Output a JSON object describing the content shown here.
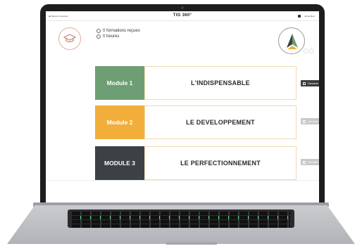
{
  "app": {
    "brand": "TIG 360°",
    "back_label": "Retour à l'accueil",
    "user_label": "Annie Rice"
  },
  "summary": {
    "trainings_received": "0 formations reçues",
    "hours": "0 heures"
  },
  "logo": {
    "trail_text": "◯◯"
  },
  "modules": [
    {
      "label": "Module 1",
      "title": "L'INDISPENSABLE",
      "status": "Démarrer",
      "color": "#6e9e74",
      "status_color": "#3c3c3c"
    },
    {
      "label": "Module 2",
      "title": "LE DEVELOPPEMENT",
      "status": "Verrouillé",
      "color": "#f2ae3a",
      "status_color": "#c9c9c9"
    },
    {
      "label": "MODULE 3",
      "title": "LE PERFECTIONNEMENT",
      "status": "Verrouillé",
      "color": "#3c4146",
      "status_color": "#c9c9c9"
    }
  ],
  "colors": {
    "accent_green": "#6e9e74",
    "accent_yellow": "#f2ae3a",
    "dark": "#3c4146",
    "circle_border": "#e8a8a0"
  },
  "icons": [
    "arrow-left-icon",
    "user-icon",
    "graduation-cap-icon",
    "check-circle-icon",
    "clock-icon",
    "play-icon",
    "lock-icon"
  ]
}
